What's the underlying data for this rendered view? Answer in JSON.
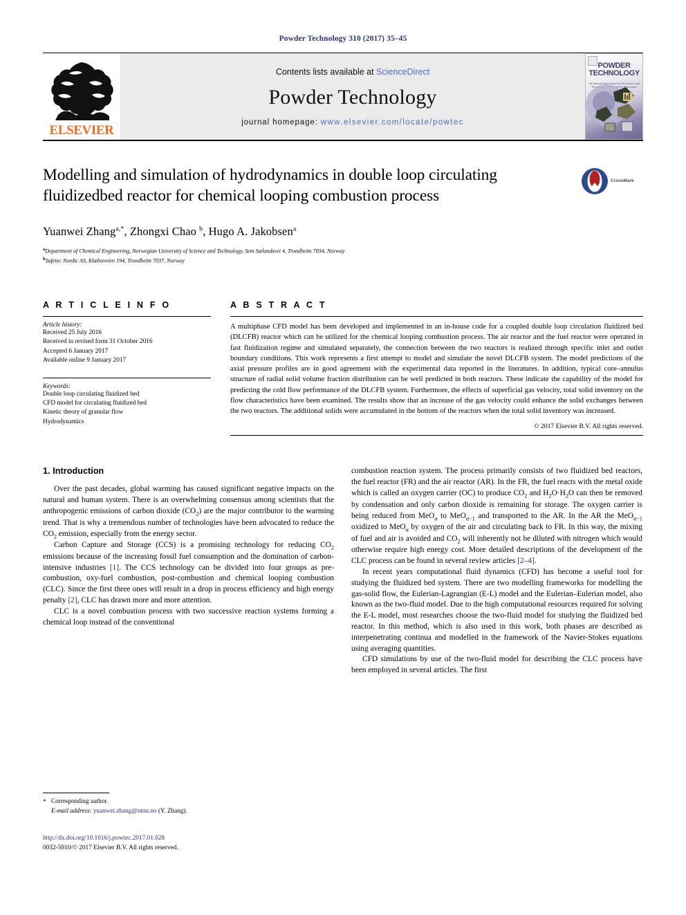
{
  "running_head": "Powder Technology 310 (2017) 35–45",
  "journal_header": {
    "contents_prefix": "Contents lists available at ",
    "sciencedirect": "ScienceDirect",
    "journal_name": "Powder Technology",
    "homepage_prefix": "journal homepage: ",
    "homepage_url": "www.elsevier.com/locate/powtec",
    "publisher_logo_text": "ELSEVIER",
    "cover_title": "POWDER TECHNOLOGY",
    "cover_subtitle": "An International Journal on the Science and Technology of Wet and Dry Particulate Systems",
    "accent_color": "#4a6fb5",
    "elsevier_orange": "#F26B21"
  },
  "title_block": {
    "title": "Modelling and simulation of hydrodynamics in double loop circulating fluidizedbed reactor for chemical looping combustion process",
    "crossmark_label": "CrossMark",
    "authors_html": "Yuanwei Zhang<sup>a,</sup><sup>*</sup>, Zhongxi Chao <sup>b</sup>, Hugo A. Jakobsen<sup>a</sup>",
    "affiliation_a": "Department of Chemical Engineering, Norwegian University of Science and Technology, Sem Sælandsvei 4, Trondheim 7034, Norway",
    "affiliation_b": "Safetec Nordic AS, Klæbuveien 194, Trondheim 7037, Norway"
  },
  "article_info": {
    "heading": "A R T I C L E   I N F O",
    "history_label": "Article history:",
    "history": [
      "Received 25 July 2016",
      "Received in revised form 31 October 2016",
      "Accepted 6 January 2017",
      "Available online 9 January 2017"
    ],
    "keywords_label": "Keywords:",
    "keywords": [
      "Double loop circulating fluidized bed",
      "CFD model for circulating fluidized bed",
      "Kinetic theory of granular flow",
      "Hydrodynamics"
    ]
  },
  "abstract": {
    "heading": "A B S T R A C T",
    "text": "A multiphase CFD model has been developed and implemented in an in-house code for a coupled double loop circulation fluidized bed (DLCFB) reactor which can be utilized for the chemical looping combustion process. The air reactor and the fuel reactor were operated in fast fluidization regime and simulated separately, the connection between the two reactors is realized through specific inlet and outlet boundary conditions. This work represents a first attempt to model and simulate the novel DLCFB system. The model predictions of the axial pressure profiles are in good agreement with the experimental data reported in the literatures. In addition, typical core–annulus structure of radial solid volume fraction distribution can be well predicted in both reactors. These indicate the capability of the model for predicting the cold flow performance of the DLCFB system. Furthermore, the effects of superficial gas velocity, total solid inventory on the flow characteristics have been examined. The results show that an increase of the gas velocity could enhance the solid exchanges between the two reactors. The additional solids were accumulated in the bottom of the reactors when the total solid inventory was increased.",
    "copyright": "© 2017 Elsevier B.V. All rights reserved."
  },
  "body": {
    "section_heading": "1. Introduction",
    "left_paragraphs": [
      "Over the past decades, global warming has caused significant negative impacts on the natural and human system. There is an overwhelming consensus among scientists that the anthropogenic emissions of carbon dioxide (CO<sub>2</sub>) are the major contributor to the warming trend. That is why a tremendous number of technologies have been advocated to reduce the CO<sub>2</sub> emission, especially from the energy sector.",
      "Carbon Capture and Storage (CCS) is a promising technology for reducing CO<sub>2</sub> emissions because of the increasing fossil fuel consumption and the domination of carbon-intensive industries <span class=\"ref\">[1]</span>. The CCS technology can be divided into four groups as pre-combustion, oxy-fuel combustion, post-combustion and chemical looping combustion (CLC). Since the first three ones will result in a drop in process efficiency and high energy penalty <span class=\"ref\">[2]</span>, CLC has drawn more and more attention.",
      "CLC is a novel combustion process with two successive reaction systems forming a chemical loop instead of the conventional"
    ],
    "right_paragraphs": [
      "combustion reaction system. The process primarily consists of two fluidized bed reactors, the fuel reactor (FR) and the air reactor (AR). In the FR, the fuel reacts with the metal oxide which is called an oxygen carrier (OC) to produce CO<sub>2</sub> and H<sub>2</sub>O·H<sub>2</sub>O can then be removed by condensation and only carbon dioxide is remaining for storage. The oxygen carrier is being reduced from MeO<sub>α</sub> to MeO<sub>α−1</sub> and transported to the AR. In the AR the MeO<sub>α−1</sub> oxidized to MeO<sub>α</sub> by oxygen of the air and circulating back to FR. In this way, the mixing of fuel and air is avoided and CO<sub>2</sub> will inherently not be diluted with nitrogen which would otherwise require high energy cost. More detailed descriptions of the development of the CLC process can be found in several review articles <span class=\"ref\">[2–4]</span>.",
      "In recent years computational fluid dynamics (CFD) has become a useful tool for studying the fluidized bed system. There are two modelling frameworks for modelling the gas-solid flow, the Eulerian-Lagrangian (E-L) model and the Eulerian–Eulerian model, also known as the two-fluid model. Due to the high computational resources required for solving the E-L model, most researches choose the two-fluid model for studying the fluidized bed reactor. In this method, which is also used in this work, both phases are described as interpenetrating continua and modelled in the framework of the Navier-Stokes equations using averaging quantities.",
      "CFD simulations by use of the two-fluid model for describing the CLC process have been employed in several articles. The first"
    ]
  },
  "footnote": {
    "star": "*",
    "corresponding": "Corresponding author.",
    "email_label": "E-mail address:",
    "email": "yuanwei.zhang@ntnu.no",
    "email_suffix": "(Y. Zhang)."
  },
  "bottom": {
    "doi": "http://dx.doi.org/10.1016/j.powtec.2017.01.028",
    "issn_line": "0032-5910/© 2017 Elsevier B.V. All rights reserved."
  }
}
